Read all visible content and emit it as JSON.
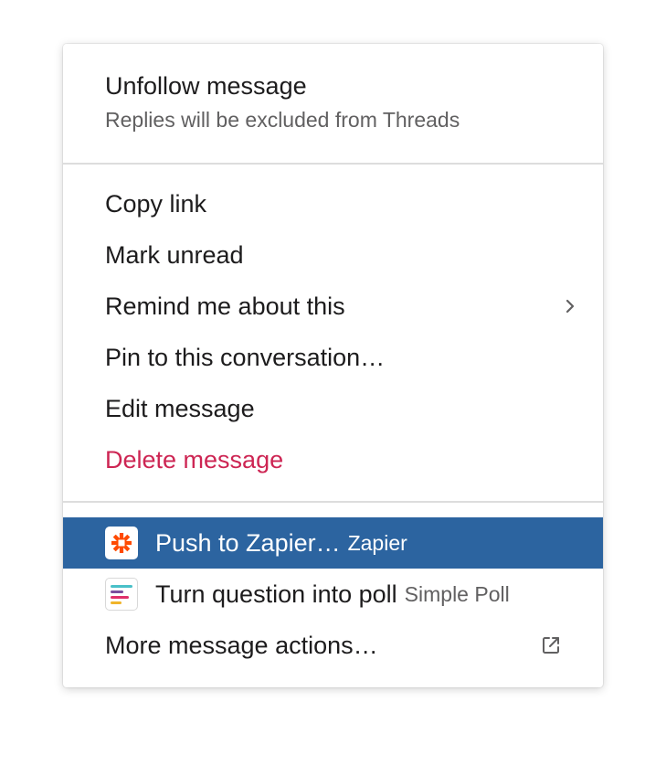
{
  "menu": {
    "header": {
      "title": "Unfollow message",
      "subtitle": "Replies will be excluded from Threads"
    },
    "items": [
      {
        "label": "Copy link"
      },
      {
        "label": "Mark unread"
      },
      {
        "label": "Remind me about this",
        "trailing_icon": "chevron-right-icon"
      },
      {
        "label": "Pin to this conversation…"
      },
      {
        "label": "Edit message"
      },
      {
        "label": "Delete message",
        "color": "#cd2553"
      }
    ],
    "app_actions": [
      {
        "label": "Push to Zapier…",
        "app": "Zapier",
        "icon": "zapier-icon",
        "highlighted": true,
        "highlight_color": "#2c64a0"
      },
      {
        "label": "Turn question into poll",
        "app": "Simple Poll",
        "icon": "simple-poll-icon"
      }
    ],
    "more": {
      "label": "More message actions…",
      "trailing_icon": "external-link-icon"
    }
  }
}
